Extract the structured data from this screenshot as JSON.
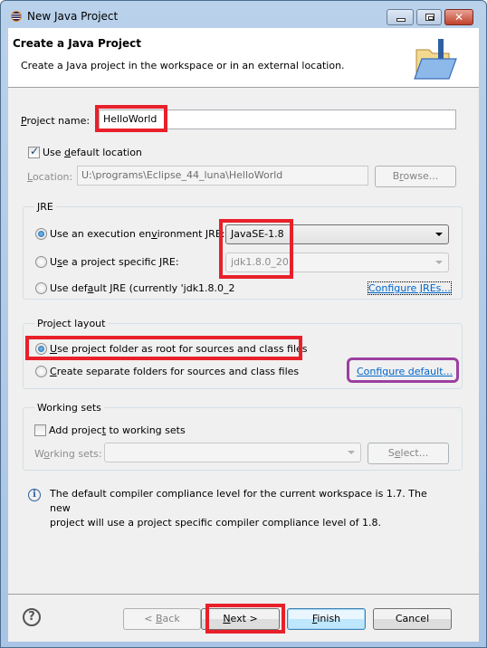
{
  "window": {
    "title": "New Java Project",
    "icon": "eclipse-icon",
    "controls": {
      "minimize": "minimize",
      "maximize": "maximize",
      "close": "✕"
    }
  },
  "header": {
    "title": "Create a Java Project",
    "description": "Create a Java project in the workspace or in an external location.",
    "image": "java-project-folder-icon"
  },
  "project": {
    "name_label_prefix": "",
    "name_label_mnemonic": "P",
    "name_label_rest": "roject name:",
    "name_value": "HelloWorld"
  },
  "location": {
    "use_default_pre": "Use ",
    "use_default_mnemonic": "d",
    "use_default_rest": "efault location",
    "use_default_checked": true,
    "label_mnemonic": "L",
    "label_rest": "ocation:",
    "value": "U:\\programs\\Eclipse_44_luna\\HelloWorld",
    "browse_pre": "B",
    "browse_mnemonic": "r",
    "browse_rest": "owse..."
  },
  "jre": {
    "group_label": "JRE",
    "options": [
      {
        "pre": "Use an execution en",
        "mnemonic": "v",
        "rest": "ironment JRE:",
        "checked": true
      },
      {
        "pre": "U",
        "mnemonic": "s",
        "rest": "e a project specific JRE:",
        "checked": false
      },
      {
        "pre": "Use def",
        "mnemonic": "a",
        "rest": "ult JRE (currently 'jdk1.8.0_2",
        "checked": false
      }
    ],
    "execution_env_value": "JavaSE-1.8",
    "project_specific_value": "jdk1.8.0_20",
    "configure_link": "Configure JREs..."
  },
  "layout": {
    "group_label": "Project layout",
    "options": [
      {
        "pre": "",
        "mnemonic": "U",
        "rest": "se project folder as root for sources and class files",
        "checked": true
      },
      {
        "pre": "",
        "mnemonic": "C",
        "rest": "reate separate folders for sources and class files",
        "checked": false
      }
    ],
    "configure_link": "Configure default..."
  },
  "working_sets": {
    "group_label": "Working sets",
    "add_pre": "Add projec",
    "add_mnemonic": "t",
    "add_rest": " to working sets",
    "add_checked": false,
    "label_pre": "W",
    "label_mnemonic": "o",
    "label_rest": "rking sets:",
    "value": "",
    "select_pre": "S",
    "select_mnemonic": "e",
    "select_rest": "lect..."
  },
  "info": {
    "icon": "info-icon",
    "line1": "The default compiler compliance level for the current workspace is 1.7. The new",
    "line2": "project will use a project specific compiler compliance level of 1.8."
  },
  "buttons": {
    "back_pre": "< ",
    "back_mnemonic": "B",
    "back_rest": "ack",
    "next_mnemonic": "N",
    "next_rest": "ext >",
    "finish_mnemonic": "F",
    "finish_rest": "inish",
    "cancel": "Cancel",
    "help": "?"
  },
  "annotations": {
    "red": "#e8202a",
    "purple": "#9b3fa0"
  }
}
